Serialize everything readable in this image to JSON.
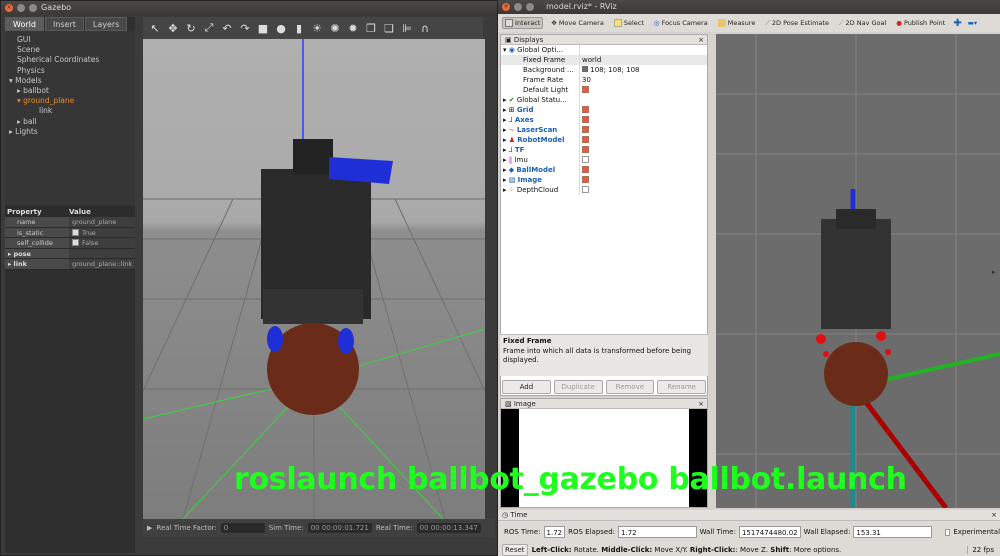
{
  "gazebo": {
    "title": "Gazebo",
    "tabs": [
      "World",
      "Insert",
      "Layers"
    ],
    "tree": [
      "GUI",
      "Scene",
      "Spherical Coordinates",
      "Physics",
      "Models",
      "ballbot",
      "ground_plane",
      "link",
      "ball",
      "Lights"
    ],
    "props_header": [
      "Property",
      "Value"
    ],
    "props": [
      {
        "k": "name",
        "v": "ground_plane"
      },
      {
        "k": "is_static",
        "v": "True"
      },
      {
        "k": "self_collide",
        "v": "False"
      },
      {
        "k": "pose",
        "v": ""
      },
      {
        "k": "link",
        "v": "ground_plane::link"
      }
    ],
    "bottom": {
      "rtf_label": "Real Time Factor:",
      "rtf_value": "0",
      "sim_label": "Sim Time:",
      "sim_value": "00 00:00:01.721",
      "real_label": "Real Time:",
      "real_value": "00 00:00:13.347"
    }
  },
  "rviz": {
    "title": "model.rviz* - RViz",
    "toolbar": [
      "Interact",
      "Move Camera",
      "Select",
      "Focus Camera",
      "Measure",
      "2D Pose Estimate",
      "2D Nav Goal",
      "Publish Point"
    ],
    "displays_title": "Displays",
    "displays": [
      {
        "name": "Global Opti...",
        "value": ""
      },
      {
        "name": "Fixed Frame",
        "value": "world"
      },
      {
        "name": "Background ...",
        "value": "108; 108; 108"
      },
      {
        "name": "Frame Rate",
        "value": "30"
      },
      {
        "name": "Default Light",
        "value": ""
      },
      {
        "name": "Global Statu...",
        "value": ""
      },
      {
        "name": "Grid",
        "value": ""
      },
      {
        "name": "Axes",
        "value": ""
      },
      {
        "name": "LaserScan",
        "value": ""
      },
      {
        "name": "RobotModel",
        "value": ""
      },
      {
        "name": "TF",
        "value": ""
      },
      {
        "name": "Imu",
        "value": ""
      },
      {
        "name": "BallModel",
        "value": ""
      },
      {
        "name": "Image",
        "value": ""
      },
      {
        "name": "DepthCloud",
        "value": ""
      }
    ],
    "desc_title": "Fixed Frame",
    "desc_text": "Frame into which all data is transformed before being displayed.",
    "buttons": [
      "Add",
      "Duplicate",
      "Remove",
      "Rename"
    ],
    "image_title": "Image",
    "time": {
      "title": "Time",
      "ros_time_label": "ROS Time:",
      "ros_time": "1.72",
      "ros_elapsed_label": "ROS Elapsed:",
      "ros_elapsed": "1.72",
      "wall_time_label": "Wall Time:",
      "wall_time": "1517474480.02",
      "wall_elapsed_label": "Wall Elapsed:",
      "wall_elapsed": "153.31",
      "experimental": "Experimental",
      "reset": "Reset",
      "hint_b1": "Left-Click:",
      "hint_t1": " Rotate. ",
      "hint_b2": "Middle-Click:",
      "hint_t2": " Move X/Y. ",
      "hint_b3": "Right-Click:",
      "hint_t3": ": Move Z. ",
      "hint_b4": "Shift",
      "hint_t4": ": More options.",
      "fps": "22 fps"
    }
  },
  "overlay": "roslaunch ballbot_gazebo ballbot.launch",
  "colors": {
    "overlay": "#1eff1e",
    "accent": "#e85a3a",
    "rviz_bg": "#6c6c6c"
  }
}
